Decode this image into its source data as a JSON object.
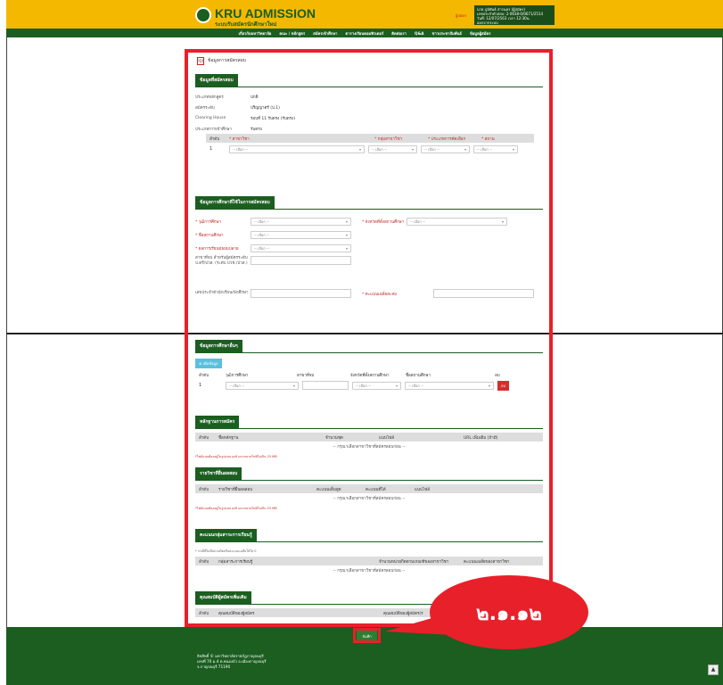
{
  "header": {
    "title": "KRU ADMISSION",
    "subtitle": "ระบบรับสมัครนักศึกษาใหม่",
    "role": "ผู้สมัคร",
    "user_line1": "นาย ภูมิพันธ์ สารนคร (ผู้สมัคร)",
    "user_line2": "เลขประจำตัวสอบ: 2-0638-0/0671/2514",
    "user_line3": "วันที่: 12/07/2563 เวลา 12:30น.",
    "user_line4": "ออกจากระบบ"
  },
  "nav": [
    "เกี่ยวกับมหาวิทยาลัย",
    "คณะ / หลักสูตร",
    "สมัครเข้าศึกษา",
    "ตารางเรียนคอมพิวเตอร์",
    "ติดต่อเรา",
    "Q&A",
    "ข่าวประชาสัมพันธ์",
    "ข้อมูลผู้สมัคร"
  ],
  "panel_title": "ข้อมูลการสมัครสอบ",
  "sec1": {
    "title": "ข้อมูลที่สมัครสอบ",
    "rows": [
      {
        "label": "ประเภทหลักสูตร",
        "value": "ปกติ"
      },
      {
        "label": "สมัครระดับ",
        "value": "ปริญญาตรี (ป.1)"
      },
      {
        "label": "Clearing House",
        "value": "รอบที่ 11 รับตรง (รับตรง)"
      },
      {
        "label": "ประเภทการเข้าศึกษา",
        "value": "รับตรง"
      }
    ],
    "table_headers": [
      "ลำดับ",
      "* สาขาวิชา",
      "* กลุ่มสาขาวิชา",
      "* ประเภทการคัดเลือก",
      "* สถาน"
    ],
    "row_no": "1",
    "select_placeholder": "-- เลือก --"
  },
  "sec2": {
    "title": "ข้อมูลการศึกษาที่ใช้ในการสมัครสอบ",
    "f1": "* วุฒิการศึกษา",
    "f2": "* จังหวัดที่ตั้งสถานศึกษา",
    "f3": "* ชื่อสถานศึกษา",
    "f4": "* ผลการเรียนมัธยมปลาย",
    "f5": "สาขาที่จบ สำหรับผู้สมัครระดับป.ตรี/ปวส. (ระดับ ปวช./ปวส.)",
    "f6": "เลขประจำตัวนักเรียน/นักศึกษา",
    "f7": "* คะแนนเฉลี่ยสะสม",
    "select_placeholder": "-- เลือก --"
  },
  "sec3": {
    "title": "ข้อมูลการศึกษาอื่นๆ",
    "add_label": "เพิ่มข้อมูล",
    "headers": [
      "ลำดับ",
      "วุฒิการศึกษา",
      "สาขาที่จบ",
      "จังหวัดที่ตั้งสถานศึกษา",
      "ชื่อสถานศึกษา",
      "ลบ"
    ],
    "row_no": "1",
    "del_label": "ลบ",
    "select_placeholder": "-- เลือก --"
  },
  "sec4": {
    "title": "หลักฐานการสมัคร",
    "headers": [
      "ลำดับ",
      "ชื่อหลักฐาน",
      "จำนวนชุด",
      "แนบไฟล์",
      "URL เพิ่มเติม (ถ้ามี)"
    ],
    "empty": "-- กรุณาเลือกสาขาวิชาที่สมัครสอบก่อน --",
    "note": "*ไฟล์แนบต้องอยู่ในรูปแบบ pdf และขนาดไฟล์ไม่เกิน 25 MB"
  },
  "sec5": {
    "title": "รายวิชาที่ยื่นผลสอบ",
    "headers": [
      "ลำดับ",
      "รายวิชาที่ยื่นผลสอบ",
      "คะแนนเต็มสูด",
      "คะแนนที่ได้",
      "แนบไฟล์"
    ],
    "empty": "-- กรุณาเลือกสาขาวิชาที่สมัครสอบก่อน --",
    "note": "*ไฟล์แนบต้องอยู่ในรูปแบบ pdf และขนาดไฟล์ไม่เกิน 25 MB"
  },
  "sec6": {
    "title": "คะแนนกลุ่มสาระการเรียนรู้",
    "note": "* กรณีที่ไม่มีหน่วยกิตหรือคะแนนเฉลี่ยให้ใส่ 0",
    "headers": [
      "ลำดับ",
      "กลุ่มสาระการเรียนรู้",
      "จำนวนหน่วยกิตตามเกณฑ์ของสาขาวิชา",
      "คะแนนเฉลี่ยของสาขาวิชา"
    ],
    "empty": "-- กรุณาเลือกสาขาวิชาที่สมัครสอบก่อน --"
  },
  "sec7": {
    "title": "คุณสมบัติผู้สมัครเพิ่มเติม",
    "headers": [
      "ลำดับ",
      "คุณสมบัติของผู้สมัคร",
      "คุณสมบัติของผู้สมัคร(ร"
    ]
  },
  "save_label": "บันทึก",
  "callout": "๒.๑.๑๒",
  "footer": {
    "line1": "ลิขสิทธิ์ © มหาวิทยาลัยราชภัฏกาญจนบุรี",
    "line2": "เลขที่ 70 ม.4 ต.หนองบัว อ.เมืองกาญจนบุรี",
    "line3": "จ.กาญจนบุรี 71190"
  }
}
